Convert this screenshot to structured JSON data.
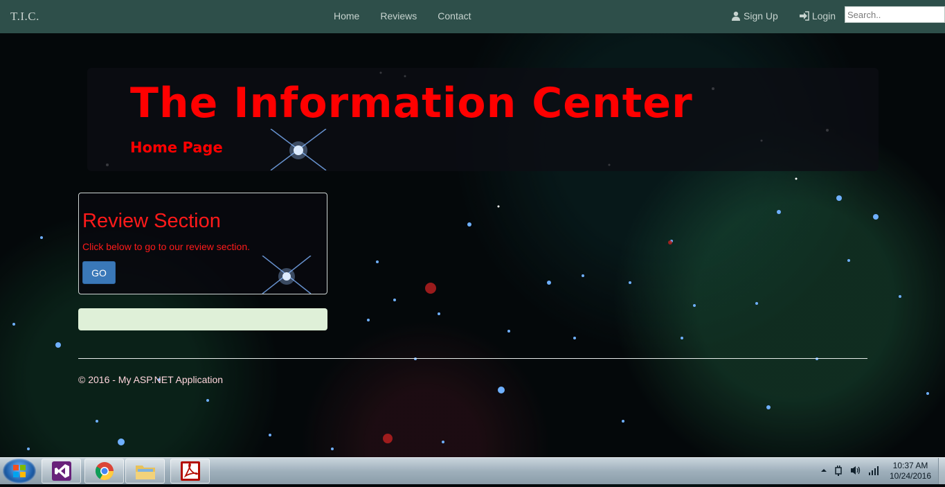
{
  "navbar": {
    "brand": "T.I.C.",
    "links": [
      "Home",
      "Reviews",
      "Contact"
    ],
    "signup_label": "Sign Up",
    "login_label": "Login",
    "search_placeholder": "Search.."
  },
  "jumbotron": {
    "title": "The Information Center",
    "subtitle": "Home Page"
  },
  "review_card": {
    "heading": "Review Section",
    "text": "Click below to go to our review section.",
    "button_label": "GO"
  },
  "footer": {
    "text": "© 2016 - My ASP.NET Application"
  },
  "taskbar": {
    "apps": [
      "visual-studio-icon",
      "chrome-icon",
      "file-explorer-icon",
      "acrobat-icon"
    ],
    "time": "10:37 AM",
    "date": "10/24/2016"
  },
  "colors": {
    "navbar": "#2e4f4a",
    "title_red": "#ff0000",
    "button_blue": "#3a78b8",
    "panel_green": "#dff0d8"
  }
}
